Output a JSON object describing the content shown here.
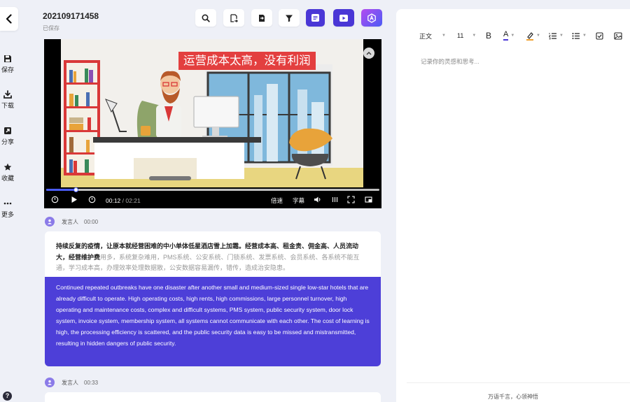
{
  "sidebar": {
    "items": [
      {
        "label": "保存",
        "icon": "save-icon"
      },
      {
        "label": "下载",
        "icon": "download-icon"
      },
      {
        "label": "分享",
        "icon": "share-icon"
      },
      {
        "label": "收藏",
        "icon": "star-icon"
      },
      {
        "label": "更多",
        "icon": "more-icon"
      }
    ],
    "help_glyph": "?"
  },
  "header": {
    "title": "202109171458",
    "status": "已保存",
    "tools": [
      "search-icon",
      "export-doc-icon",
      "import-icon",
      "filter-icon",
      "subtitle-icon",
      "video-icon",
      "ai-icon"
    ]
  },
  "video": {
    "caption": "运营成本太高，没有利润",
    "current_time": "00:12",
    "separator": "/",
    "duration": "02:21",
    "progress": 0.089,
    "speed_label": "倍速",
    "subtitle_label": "字幕",
    "accent_color": "#4b5cf5"
  },
  "transcript": {
    "segments": [
      {
        "speaker": "发言人",
        "time": "00:00",
        "zh_bold": "持续反复的疫情，让原本就经营困难的中小单体低星酒店雪上加霜。经营成本高、租金贵、佣金高、人员流动大，经营维护费",
        "zh_rest": "用多，系统复杂难用，PMS系统、公安系统、门锁系统、发票系统、会员系统、各系统不能互通，学习成本高，办理效率处理数据散，公安数据容易漏传，错传，造成治安隐患。",
        "en": "Continued repeated outbreaks have one disaster after another small and medium-sized single low-star hotels that are already difficult to operate. High operating costs, high rents, high commissions, large personnel turnover, high operating and maintenance costs, complex and difficult systems, PMS system, public security system, door lock system, invoice system, membership system, all systems cannot communicate with each other. The cost of learning is high, the processing efficiency is scattered, and the public security data is easy to be missed and mistransmitted, resulting in hidden dangers of public security."
      },
      {
        "speaker": "发言人",
        "time": "00:33"
      }
    ],
    "highlight_color": "#4d3fd8"
  },
  "notes": {
    "toolbar": {
      "style_select": "正文",
      "size_select": "11",
      "bold_label": "B",
      "font_color_label": "A",
      "font_color_bar": "#4a37d6",
      "highlight_bar": "#f0a030"
    },
    "placeholder": "记录你的灵感和思考...",
    "footer": "万语千言，心领神悟"
  }
}
